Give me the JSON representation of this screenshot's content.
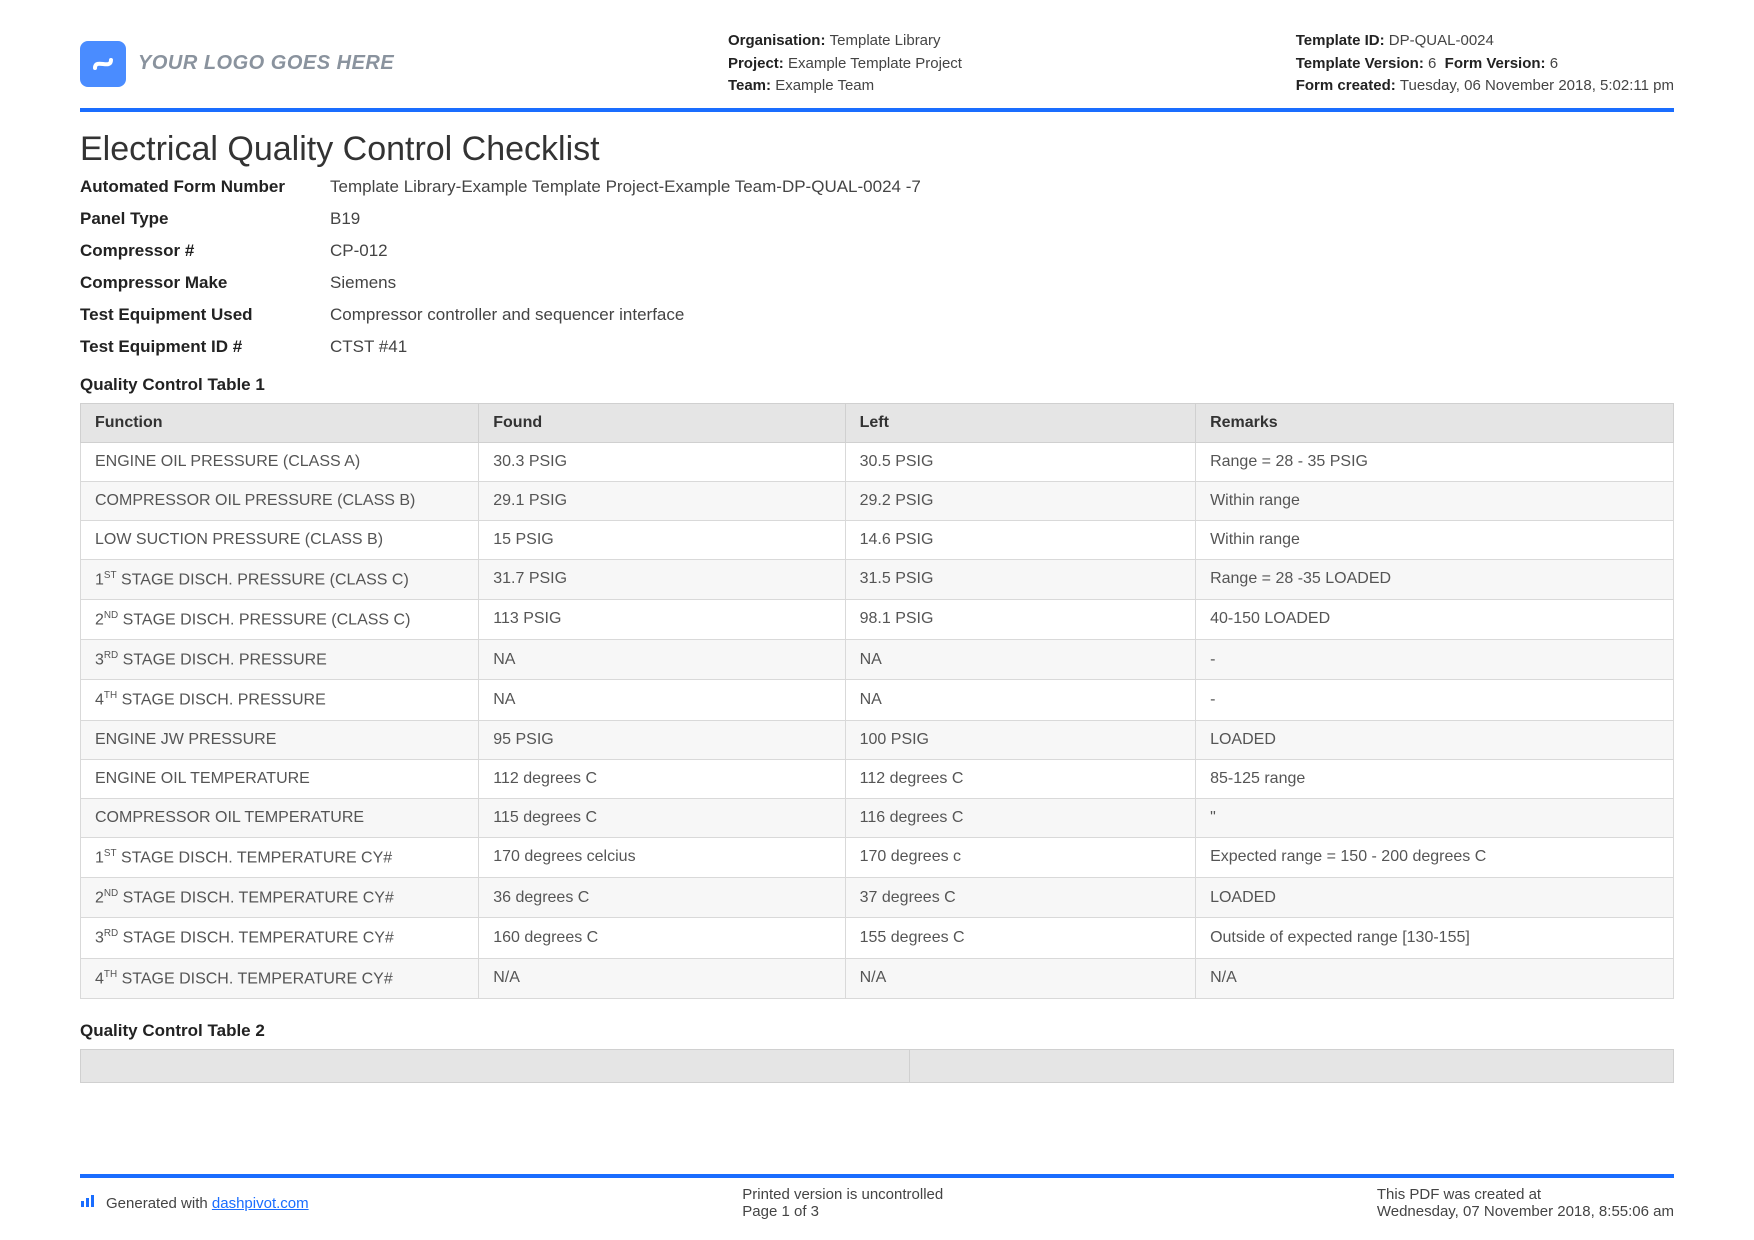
{
  "logo_text": "YOUR LOGO GOES HERE",
  "header_meta1": {
    "org_label": "Organisation:",
    "org_value": "Template Library",
    "project_label": "Project:",
    "project_value": "Example Template Project",
    "team_label": "Team:",
    "team_value": "Example Team"
  },
  "header_meta2": {
    "tid_label": "Template ID:",
    "tid_value": "DP-QUAL-0024",
    "tver_label": "Template Version:",
    "tver_value": "6",
    "fver_label": "Form Version:",
    "fver_value": "6",
    "fcreated_label": "Form created:",
    "fcreated_value": "Tuesday, 06 November 2018, 5:02:11 pm"
  },
  "title": "Electrical Quality Control Checklist",
  "kv": [
    {
      "k": "Automated Form Number",
      "v": "Template Library-Example Template Project-Example Team-DP-QUAL-0024   -7"
    },
    {
      "k": "Panel Type",
      "v": "B19"
    },
    {
      "k": "Compressor #",
      "v": "CP-012"
    },
    {
      "k": "Compressor Make",
      "v": "Siemens"
    },
    {
      "k": "Test Equipment Used",
      "v": "Compressor controller and sequencer interface"
    },
    {
      "k": "Test Equipment ID #",
      "v": "CTST #41"
    }
  ],
  "table1": {
    "title": "Quality Control Table 1",
    "headers": {
      "c0": "Function",
      "c1": "Found",
      "c2": "Left",
      "c3": "Remarks"
    },
    "rows": [
      {
        "func_pre": "",
        "func_sup": "",
        "func_post": "ENGINE OIL PRESSURE (CLASS A)",
        "found": "30.3 PSIG",
        "left": "30.5 PSIG",
        "remarks": "Range = 28 - 35 PSIG"
      },
      {
        "func_pre": "",
        "func_sup": "",
        "func_post": "COMPRESSOR OIL PRESSURE (CLASS B)",
        "found": "29.1 PSIG",
        "left": "29.2 PSIG",
        "remarks": "Within range"
      },
      {
        "func_pre": "",
        "func_sup": "",
        "func_post": "LOW SUCTION PRESSURE (CLASS B)",
        "found": "15 PSIG",
        "left": "14.6 PSIG",
        "remarks": "Within range"
      },
      {
        "func_pre": "1",
        "func_sup": "ST",
        "func_post": " STAGE DISCH. PRESSURE (CLASS C)",
        "found": "31.7 PSIG",
        "left": "31.5 PSIG",
        "remarks": "Range = 28 -35 LOADED"
      },
      {
        "func_pre": "2",
        "func_sup": "ND",
        "func_post": " STAGE DISCH. PRESSURE (CLASS C)",
        "found": "113 PSIG",
        "left": "98.1 PSIG",
        "remarks": "40-150 LOADED"
      },
      {
        "func_pre": "3",
        "func_sup": "RD",
        "func_post": " STAGE DISCH. PRESSURE",
        "found": "NA",
        "left": "NA",
        "remarks": "-"
      },
      {
        "func_pre": "4",
        "func_sup": "TH",
        "func_post": " STAGE DISCH. PRESSURE",
        "found": "NA",
        "left": "NA",
        "remarks": "-"
      },
      {
        "func_pre": "",
        "func_sup": "",
        "func_post": "ENGINE JW PRESSURE",
        "found": "95 PSIG",
        "left": "100 PSIG",
        "remarks": "LOADED"
      },
      {
        "func_pre": "",
        "func_sup": "",
        "func_post": "ENGINE OIL TEMPERATURE",
        "found": "112 degrees C",
        "left": "112 degrees C",
        "remarks": "85-125 range"
      },
      {
        "func_pre": "",
        "func_sup": "",
        "func_post": "COMPRESSOR OIL TEMPERATURE",
        "found": "115 degrees C",
        "left": "116 degrees C",
        "remarks": "\""
      },
      {
        "func_pre": "1",
        "func_sup": "ST",
        "func_post": " STAGE DISCH. TEMPERATURE CY#",
        "found": "170 degrees celcius",
        "left": "170 degrees c",
        "remarks": "Expected range = 150 - 200 degrees C"
      },
      {
        "func_pre": "2",
        "func_sup": "ND",
        "func_post": " STAGE DISCH. TEMPERATURE CY#",
        "found": "36 degrees C",
        "left": "37 degrees C",
        "remarks": "LOADED"
      },
      {
        "func_pre": "3",
        "func_sup": "RD",
        "func_post": " STAGE DISCH. TEMPERATURE CY#",
        "found": "160 degrees C",
        "left": "155 degrees C",
        "remarks": "Outside of expected range [130-155]"
      },
      {
        "func_pre": "4",
        "func_sup": "TH",
        "func_post": " STAGE DISCH. TEMPERATURE CY#",
        "found": "N/A",
        "left": "N/A",
        "remarks": "N/A"
      }
    ]
  },
  "table2_title": "Quality Control Table 2",
  "footer": {
    "generated_prefix": "Generated with ",
    "generated_link": "dashpivot.com",
    "uncontrolled": "Printed version is uncontrolled",
    "page": "Page 1 of 3",
    "created_at_label": "This PDF was created at",
    "created_at_value": "Wednesday, 07 November 2018, 8:55:06 am"
  }
}
